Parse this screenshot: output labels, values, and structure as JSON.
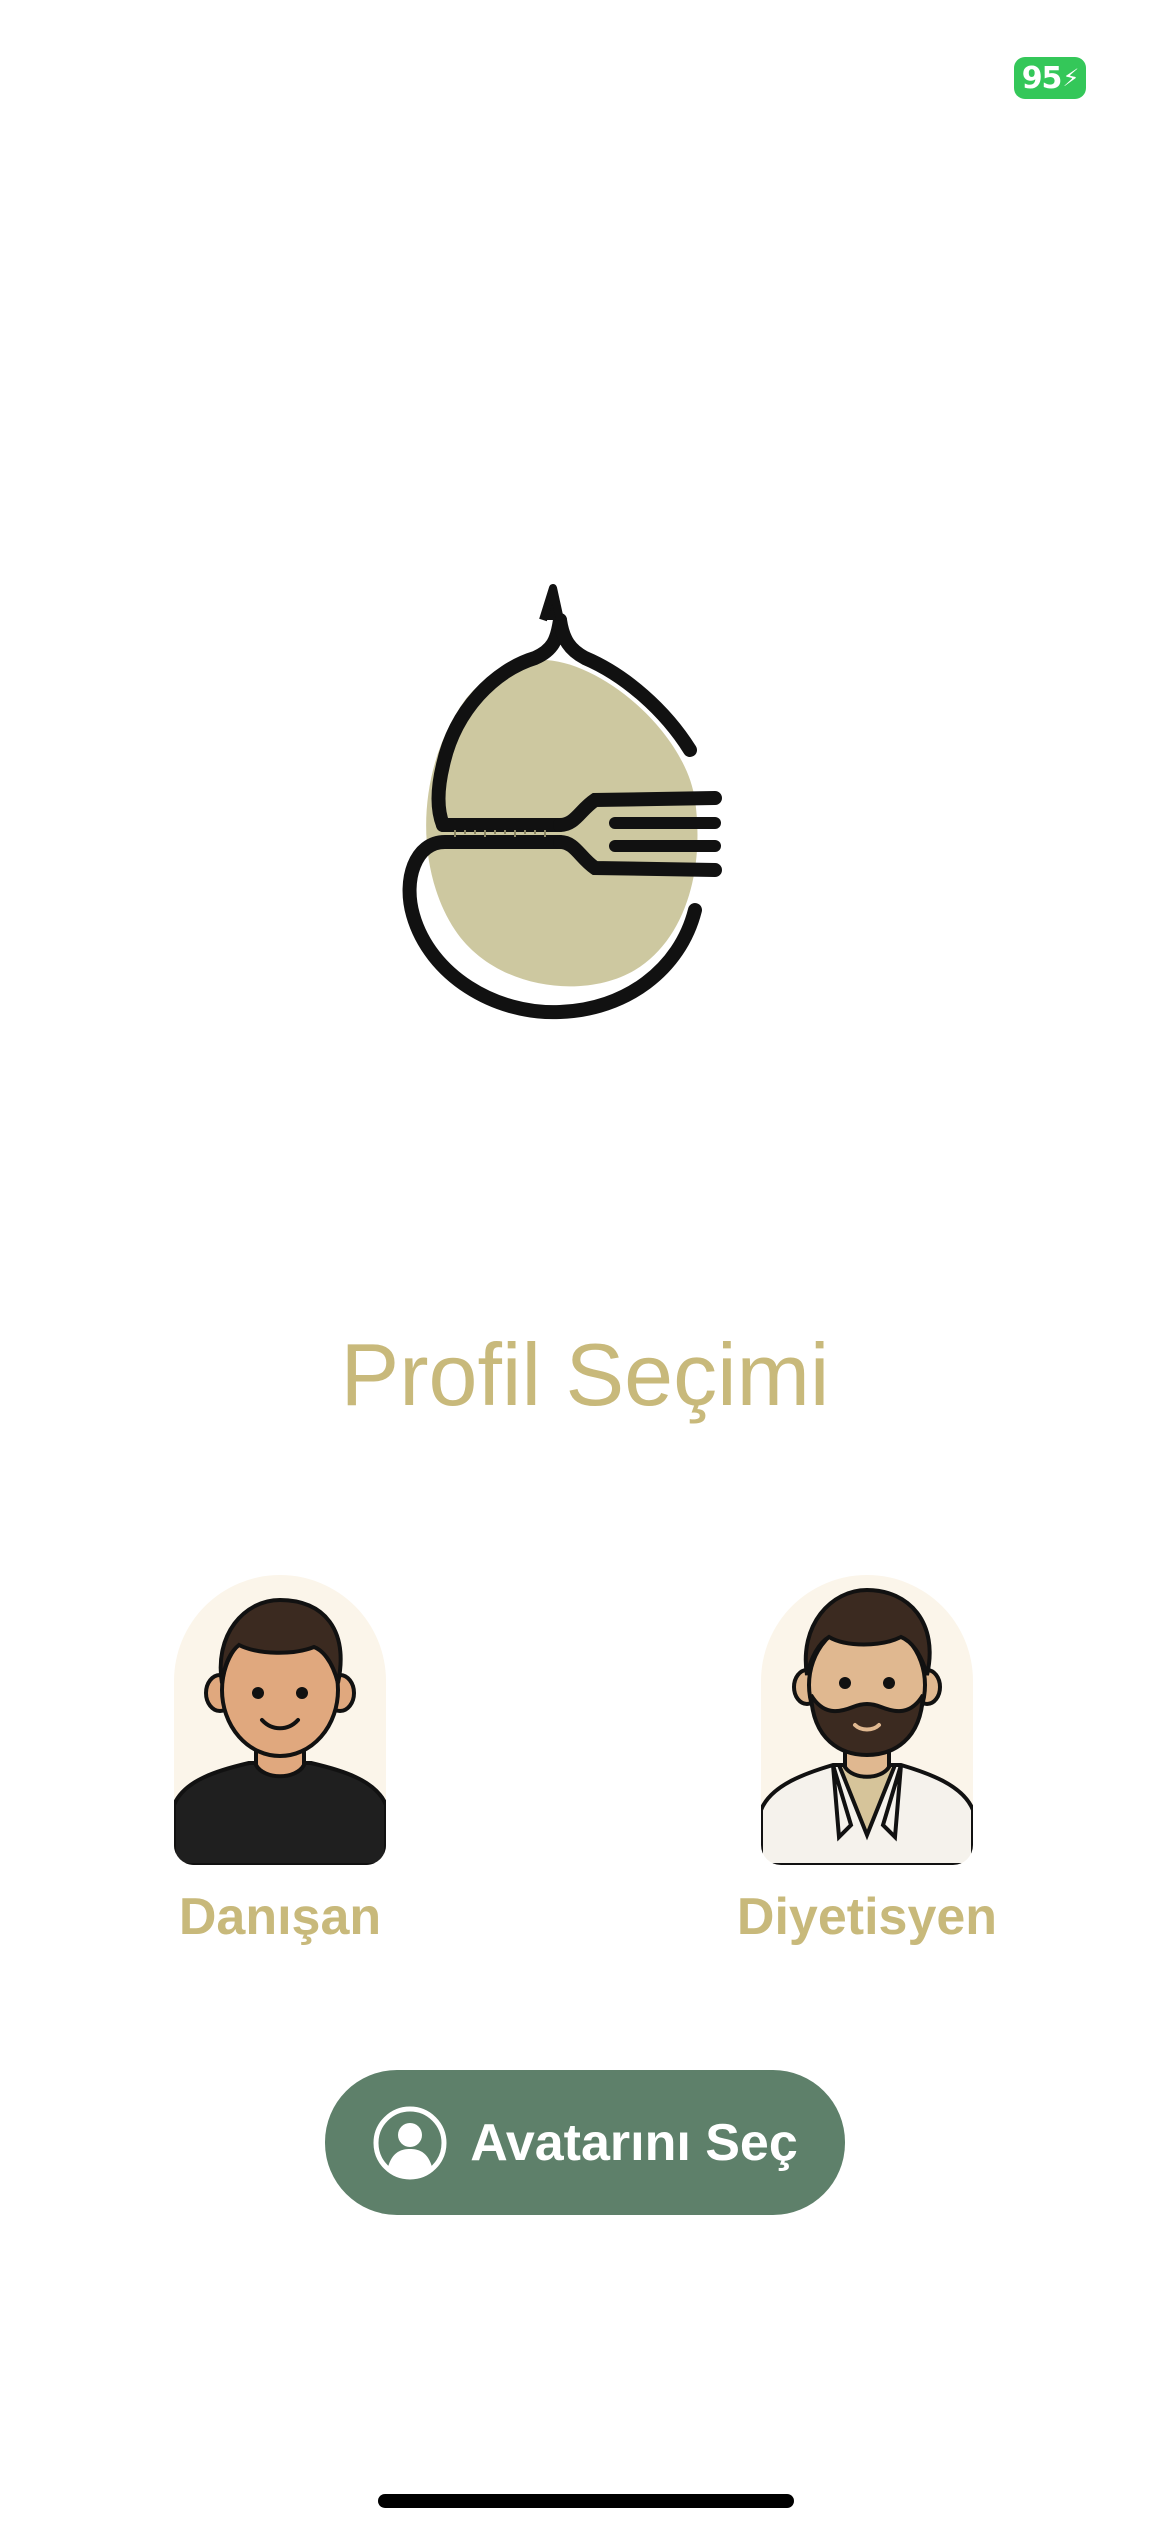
{
  "status_bar": {
    "battery_level": "95",
    "battery_charging_glyph": "⚡",
    "battery_color": "#34c759"
  },
  "logo": {
    "icon": "fork-droplet-logo",
    "fill_color": "#cdc8a0"
  },
  "title": "Profil Seçimi",
  "profiles": [
    {
      "label": "Danışan",
      "avatar": "client-avatar"
    },
    {
      "label": "Diyetisyen",
      "avatar": "dietitian-avatar"
    }
  ],
  "choose_button": {
    "label": "Avatarını Seç",
    "icon": "person-circle-icon",
    "background": "#5e806a"
  },
  "colors": {
    "accent": "#c8b97b",
    "avatar_background": "#fbf5ea"
  }
}
